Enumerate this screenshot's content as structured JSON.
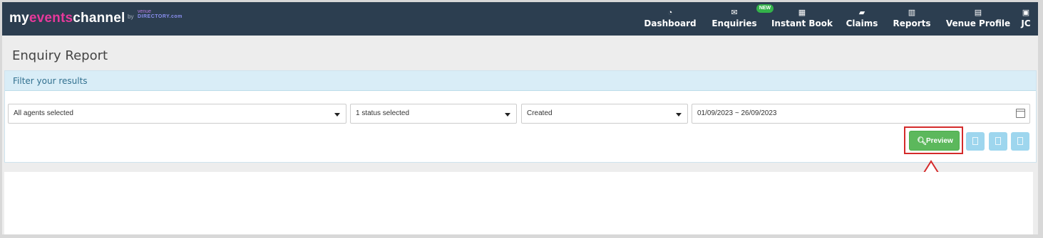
{
  "brand": {
    "prefix": "my",
    "highlight": "events",
    "suffix": "channel",
    "by": "by",
    "partner_top": "venue",
    "partner_bottom": "DIRECTORY.com"
  },
  "nav": {
    "items": [
      {
        "label": "Dashboard",
        "icon": "tachometer-icon",
        "glyph": "◔"
      },
      {
        "label": "Enquiries",
        "icon": "envelope-icon",
        "glyph": "✉"
      },
      {
        "label": "Instant Book",
        "icon": "calendar-icon",
        "glyph": "▦",
        "badge": "NEW"
      },
      {
        "label": "Claims",
        "icon": "book-icon",
        "glyph": "▰"
      },
      {
        "label": "Reports",
        "icon": "bar-chart-icon",
        "glyph": "▥"
      },
      {
        "label": "Venue Profile",
        "icon": "building-icon",
        "glyph": "▤"
      },
      {
        "label": "JC",
        "icon": "user-icon",
        "glyph": "▣"
      }
    ]
  },
  "page": {
    "title": "Enquiry Report"
  },
  "filter": {
    "heading": "Filter your results",
    "agents": "All agents selected",
    "status": "1 status selected",
    "date_type": "Created",
    "date_range": "01/09/2023 ~ 26/09/2023"
  },
  "actions": {
    "preview_label": "Preview",
    "preview_icon": "search-icon"
  },
  "colors": {
    "navbar": "#2c3e50",
    "accent": "#e6399b",
    "preview": "#5cb85c",
    "highlight_box": "#d42a2a"
  }
}
